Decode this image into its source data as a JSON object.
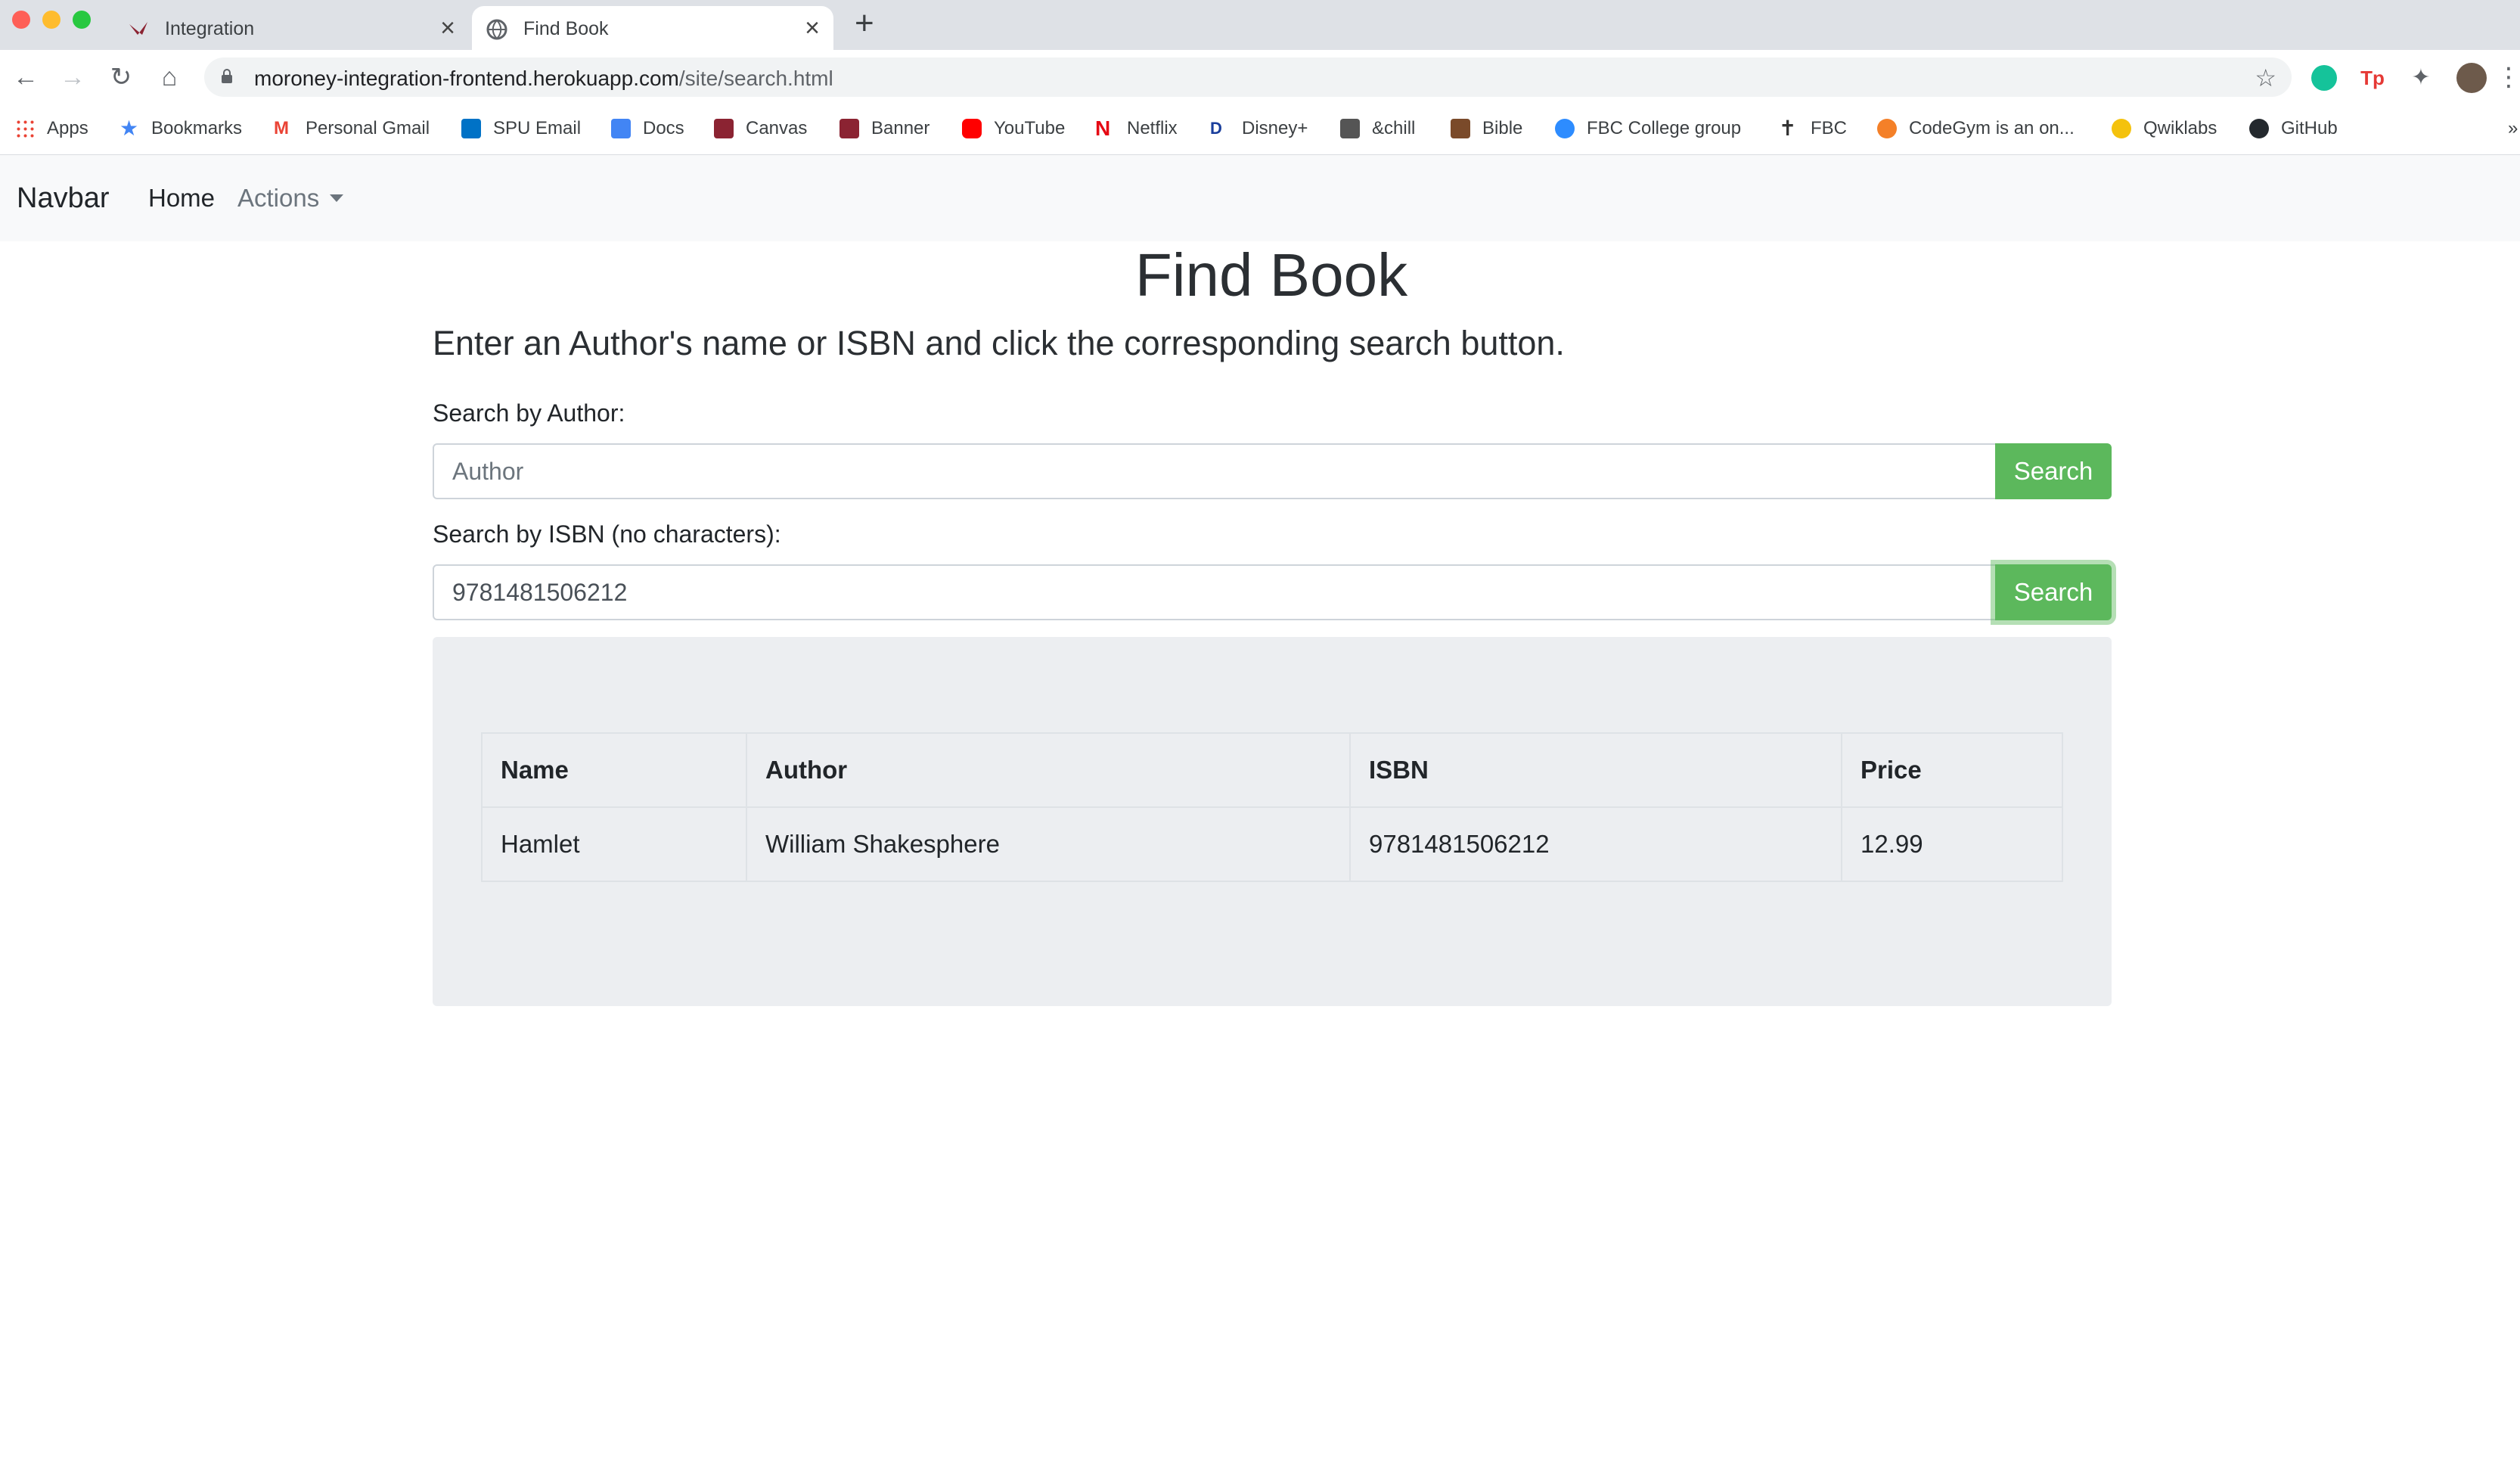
{
  "browser": {
    "tabs": [
      {
        "title": "Integration",
        "active": false
      },
      {
        "title": "Find Book",
        "active": true
      }
    ],
    "url_host": "moroney-integration-frontend.herokuapp.com",
    "url_path": "/site/search.html",
    "bookmarks": [
      {
        "label": "Apps",
        "icon": "apps-grid-icon",
        "color": "#ea4335"
      },
      {
        "label": "Bookmarks",
        "icon": "star-icon",
        "color": "#4285f4"
      },
      {
        "label": "Personal Gmail",
        "icon": "gmail-icon",
        "color": "#ea4335"
      },
      {
        "label": "SPU Email",
        "icon": "outlook-icon",
        "color": "#0072c6"
      },
      {
        "label": "Docs",
        "icon": "docs-icon",
        "color": "#4285f4"
      },
      {
        "label": "Canvas",
        "icon": "canvas-icon",
        "color": "#8b2332"
      },
      {
        "label": "Banner",
        "icon": "banner-icon",
        "color": "#8b2332"
      },
      {
        "label": "YouTube",
        "icon": "youtube-icon",
        "color": "#ff0000"
      },
      {
        "label": "Netflix",
        "icon": "netflix-icon",
        "color": "#e50914"
      },
      {
        "label": "Disney+",
        "icon": "disney-icon",
        "color": "#1a3e9c"
      },
      {
        "label": "&chill",
        "icon": "chill-icon",
        "color": "#555555"
      },
      {
        "label": "Bible",
        "icon": "bible-icon",
        "color": "#7a4a2a"
      },
      {
        "label": "FBC College group",
        "icon": "zoom-icon",
        "color": "#2d8cff"
      },
      {
        "label": "FBC",
        "icon": "cross-icon",
        "color": "#333333"
      },
      {
        "label": "CodeGym is an on...",
        "icon": "codegym-icon",
        "color": "#f48028"
      },
      {
        "label": "Qwiklabs",
        "icon": "qwiklabs-icon",
        "color": "#f4c20d"
      },
      {
        "label": "GitHub",
        "icon": "github-icon",
        "color": "#24292e"
      }
    ]
  },
  "navbar": {
    "brand": "Navbar",
    "home": "Home",
    "actions": "Actions"
  },
  "page": {
    "title": "Find Book",
    "lead": "Enter an Author's name or ISBN and click the corresponding search button.",
    "author_label": "Search by Author:",
    "author_placeholder": "Author",
    "author_value": "",
    "isbn_label": "Search by ISBN (no characters):",
    "isbn_value": "9781481506212",
    "search_button": "Search"
  },
  "results": {
    "columns": [
      "Name",
      "Author",
      "ISBN",
      "Price"
    ],
    "rows": [
      [
        "Hamlet",
        "William Shakesphere",
        "9781481506212",
        "12.99"
      ]
    ]
  },
  "colors": {
    "button": "#5cb85c",
    "results_bg": "#eceef1",
    "navbar_bg": "#f8f9fa"
  }
}
